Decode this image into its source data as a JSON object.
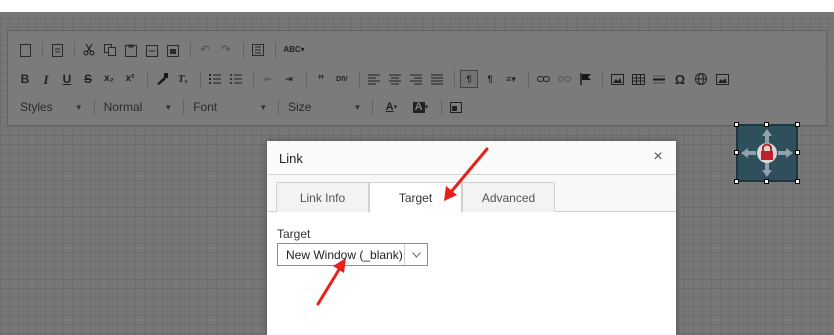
{
  "toolbar": {
    "row1_icons": [
      "new-page-icon",
      "preview-icon",
      "cut-icon",
      "copy-icon",
      "paste-icon",
      "paste-text-icon",
      "paste-word-icon",
      "undo-icon",
      "redo-icon",
      "find-icon",
      "spellcheck-icon"
    ],
    "row2": {
      "bold": "B",
      "italic": "I",
      "underline": "U",
      "strike": "S",
      "subscript": "x₂",
      "superscript": "x²",
      "omega": "Ω"
    },
    "styles_label": "Styles",
    "format_label": "Normal",
    "font_label": "Font",
    "size_label": "Size",
    "text_color": "A",
    "bg_color": "A"
  },
  "dialog": {
    "title": "Link",
    "close": "×",
    "tabs": [
      {
        "label": "Link Info",
        "active": false
      },
      {
        "label": "Target",
        "active": true
      },
      {
        "label": "Advanced",
        "active": false
      }
    ],
    "target_label": "Target",
    "target_value": "New Window (_blank)",
    "target_arrow": "∨"
  },
  "annotations": {
    "arrow_color": "#e8201c",
    "arrow_count": 2
  },
  "colors": {
    "overlay": "#000000",
    "select_border": "#5b9bd5",
    "widget_bg": "#2f4f5d"
  }
}
